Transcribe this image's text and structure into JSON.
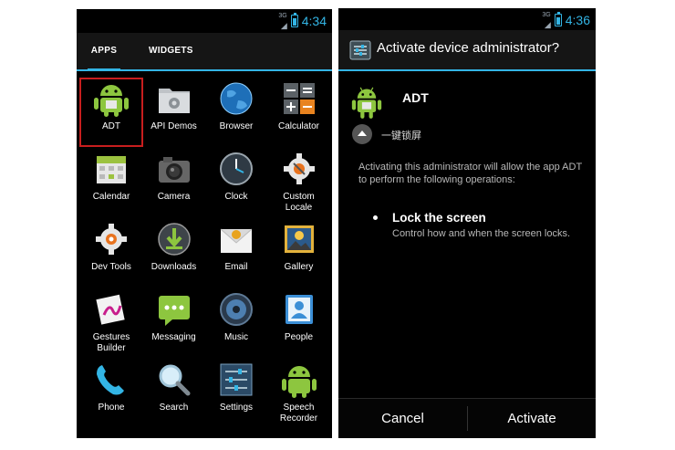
{
  "left_screen": {
    "status": {
      "signal": "3G",
      "time": "4:34"
    },
    "tabs": [
      {
        "label": "APPS"
      },
      {
        "label": "WIDGETS"
      }
    ],
    "apps": [
      {
        "label": "ADT"
      },
      {
        "label": "API Demos"
      },
      {
        "label": "Browser"
      },
      {
        "label": "Calculator"
      },
      {
        "label": "Calendar"
      },
      {
        "label": "Camera"
      },
      {
        "label": "Clock"
      },
      {
        "label": "Custom\nLocale"
      },
      {
        "label": "Dev Tools"
      },
      {
        "label": "Downloads"
      },
      {
        "label": "Email"
      },
      {
        "label": "Gallery"
      },
      {
        "label": "Gestures\nBuilder"
      },
      {
        "label": "Messaging"
      },
      {
        "label": "Music"
      },
      {
        "label": "People"
      },
      {
        "label": "Phone"
      },
      {
        "label": "Search"
      },
      {
        "label": "Settings"
      },
      {
        "label": "Speech\nRecorder"
      }
    ]
  },
  "right_screen": {
    "status": {
      "signal": "3G",
      "time": "4:36"
    },
    "dialog_title": "Activate device administrator?",
    "app_name": "ADT",
    "chinese_text": "一键锁屏",
    "description": "Activating this administrator will allow the app ADT to perform the following operations:",
    "policy": {
      "title": "Lock the screen",
      "desc": "Control how and when the screen locks."
    },
    "buttons": {
      "cancel": "Cancel",
      "activate": "Activate"
    }
  },
  "colors": {
    "accent": "#33b5e5",
    "selection": "#c81e1e"
  }
}
